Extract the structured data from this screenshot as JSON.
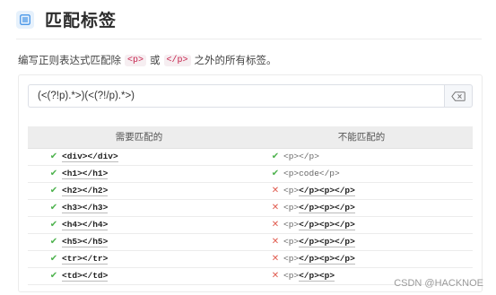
{
  "header": {
    "title": "匹配标签",
    "icon": "document-list-icon"
  },
  "description": {
    "prefix": "编写正则表达式匹配除",
    "code1": "<p>",
    "middle": "或",
    "code2": "</p>",
    "suffix": "之外的所有标签。"
  },
  "regex": {
    "value": "(<(?!p).*>)(<(?!/p).*>)",
    "clear_icon": "backspace-clear-icon"
  },
  "table": {
    "header_match": "需要匹配的",
    "header_nomatch": "不能匹配的",
    "rows": [
      {
        "left": "<div></div>",
        "right_pre": "",
        "right_match": "",
        "right_post": "<p></p>",
        "right_status": "ok"
      },
      {
        "left": "<h1></h1>",
        "right_pre": "",
        "right_match": "",
        "right_post": "<p>code</p>",
        "right_status": "ok"
      },
      {
        "left": "<h2></h2>",
        "right_pre": "<p>",
        "right_match": "</p><p></p>",
        "right_post": "",
        "right_status": "fail"
      },
      {
        "left": "<h3></h3>",
        "right_pre": "<p>",
        "right_match": "</p><p></p>",
        "right_post": "",
        "right_status": "fail"
      },
      {
        "left": "<h4></h4>",
        "right_pre": "<p>",
        "right_match": "</p><p></p>",
        "right_post": "",
        "right_status": "fail"
      },
      {
        "left": "<h5></h5>",
        "right_pre": "<p>",
        "right_match": "</p><p></p>",
        "right_post": "",
        "right_status": "fail"
      },
      {
        "left": "<tr></tr>",
        "right_pre": "<p>",
        "right_match": "</p><p></p>",
        "right_post": "",
        "right_status": "fail"
      },
      {
        "left": "<td></td>",
        "right_pre": "<p>",
        "right_match": "</p><p>",
        "right_post": "",
        "right_status": "fail"
      }
    ]
  },
  "watermark": "CSDN @HACKNOE",
  "colors": {
    "ok": "#4fb34f",
    "fail": "#e05a4e",
    "accent": "#3a8ee6"
  }
}
